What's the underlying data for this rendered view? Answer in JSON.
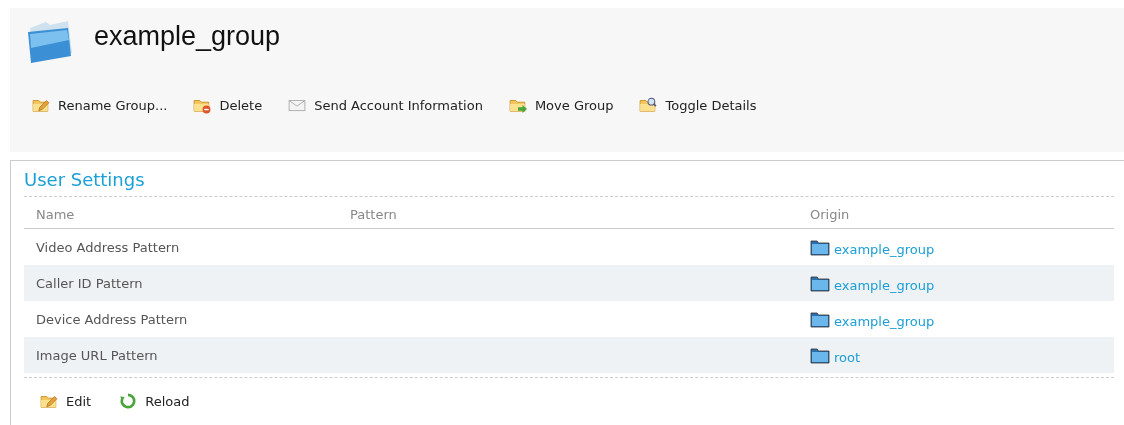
{
  "header": {
    "title": "example_group"
  },
  "toolbar": [
    {
      "kind": "rename",
      "label": "Rename Group..."
    },
    {
      "kind": "delete",
      "label": "Delete"
    },
    {
      "kind": "mail",
      "label": "Send Account Information"
    },
    {
      "kind": "move",
      "label": "Move Group"
    },
    {
      "kind": "details",
      "label": "Toggle Details"
    }
  ],
  "panel": {
    "title": "User Settings",
    "table": {
      "columns": [
        "Name",
        "Pattern",
        "Origin"
      ],
      "rows": [
        {
          "name": "Video Address Pattern",
          "origin": "example_group"
        },
        {
          "name": "Caller ID Pattern",
          "origin": "example_group"
        },
        {
          "name": "Device Address Pattern",
          "origin": "example_group"
        },
        {
          "name": "Image URL Pattern",
          "origin": "root"
        }
      ]
    },
    "actions": [
      {
        "kind": "edit",
        "label": "Edit"
      },
      {
        "kind": "reload",
        "label": "Reload"
      }
    ]
  }
}
